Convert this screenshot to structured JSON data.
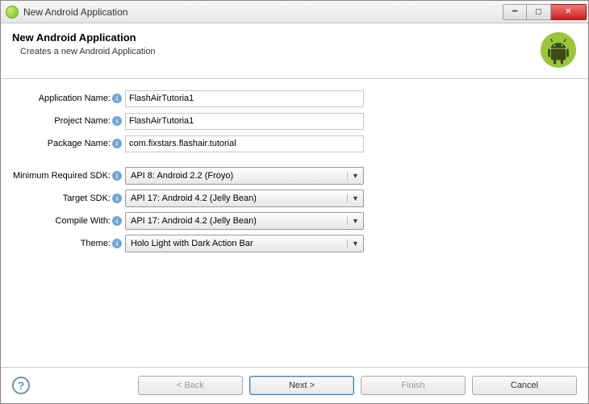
{
  "window": {
    "title": "New Android Application"
  },
  "header": {
    "heading": "New Android Application",
    "subtitle": "Creates a new Android Application"
  },
  "form": {
    "app_name": {
      "label": "Application Name:",
      "value": "FlashAirTutoria1"
    },
    "project_name": {
      "label": "Project Name:",
      "value": "FlashAirTutoria1"
    },
    "package_name": {
      "label": "Package Name:",
      "value": "com.fixstars.flashair.tutorial"
    },
    "min_sdk": {
      "label": "Minimum Required SDK:",
      "value": "API 8: Android 2.2 (Froyo)"
    },
    "target_sdk": {
      "label": "Target SDK:",
      "value": "API 17: Android 4.2 (Jelly Bean)"
    },
    "compile_with": {
      "label": "Compile With:",
      "value": "API 17: Android 4.2 (Jelly Bean)"
    },
    "theme": {
      "label": "Theme:",
      "value": "Holo Light with Dark Action Bar"
    }
  },
  "buttons": {
    "back": "< Back",
    "next": "Next >",
    "finish": "Finish",
    "cancel": "Cancel"
  }
}
